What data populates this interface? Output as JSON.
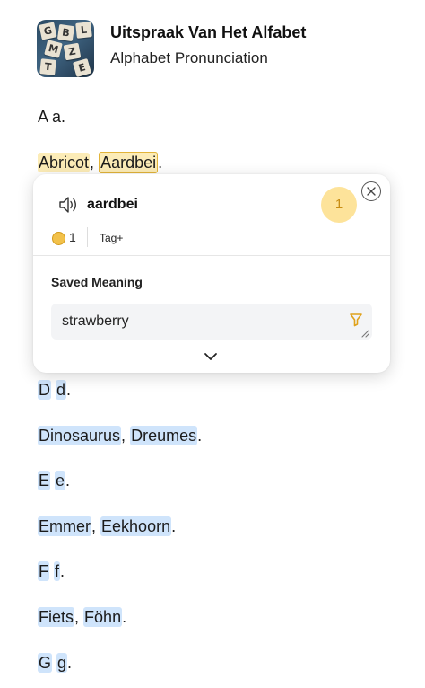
{
  "header": {
    "title": "Uitspraak Van Het Alfabet",
    "subtitle": "Alphabet Pronunciation",
    "thumbnail_tiles": [
      "G",
      "B",
      "L",
      "M",
      "Z",
      "T",
      "E"
    ]
  },
  "lines": {
    "a_letter": "A a.",
    "a_word1": "Abricot",
    "a_sep": ",",
    "a_word2": "Aardbei",
    "a_end": ".",
    "d_upper": "D",
    "d_lower": "d",
    "d_end": ".",
    "d_word1": "Dinosaurus",
    "d_sep": ",",
    "d_word2": "Dreumes",
    "d_words_end": ".",
    "e_upper": "E",
    "e_lower": "e",
    "e_end": ".",
    "e_word1": "Emmer",
    "e_sep": ",",
    "e_word2": "Eekhoorn",
    "e_words_end": ".",
    "f_upper": "F",
    "f_lower": "f",
    "f_end": ".",
    "f_word1": "Fiets",
    "f_sep": ",",
    "f_word2": "Föhn",
    "f_words_end": ".",
    "g_upper": "G",
    "g_lower": "g",
    "g_end": "."
  },
  "popup": {
    "word": "aardbei",
    "level": "1",
    "coins": "1",
    "tag_label": "Tag+",
    "saved_meaning_label": "Saved Meaning",
    "meaning": "strawberry"
  },
  "colors": {
    "highlight_yellow": "#fcecb7",
    "highlight_yellow_border": "#e2b43a",
    "highlight_blue": "#cfe4fb",
    "level_bg": "#fde39a",
    "level_text": "#c88d12",
    "accent_orange": "#e0a21c"
  },
  "icons": [
    "speaker-icon",
    "close-icon",
    "coin-icon",
    "filter-icon",
    "resize-handle-icon",
    "chevron-down-icon"
  ]
}
